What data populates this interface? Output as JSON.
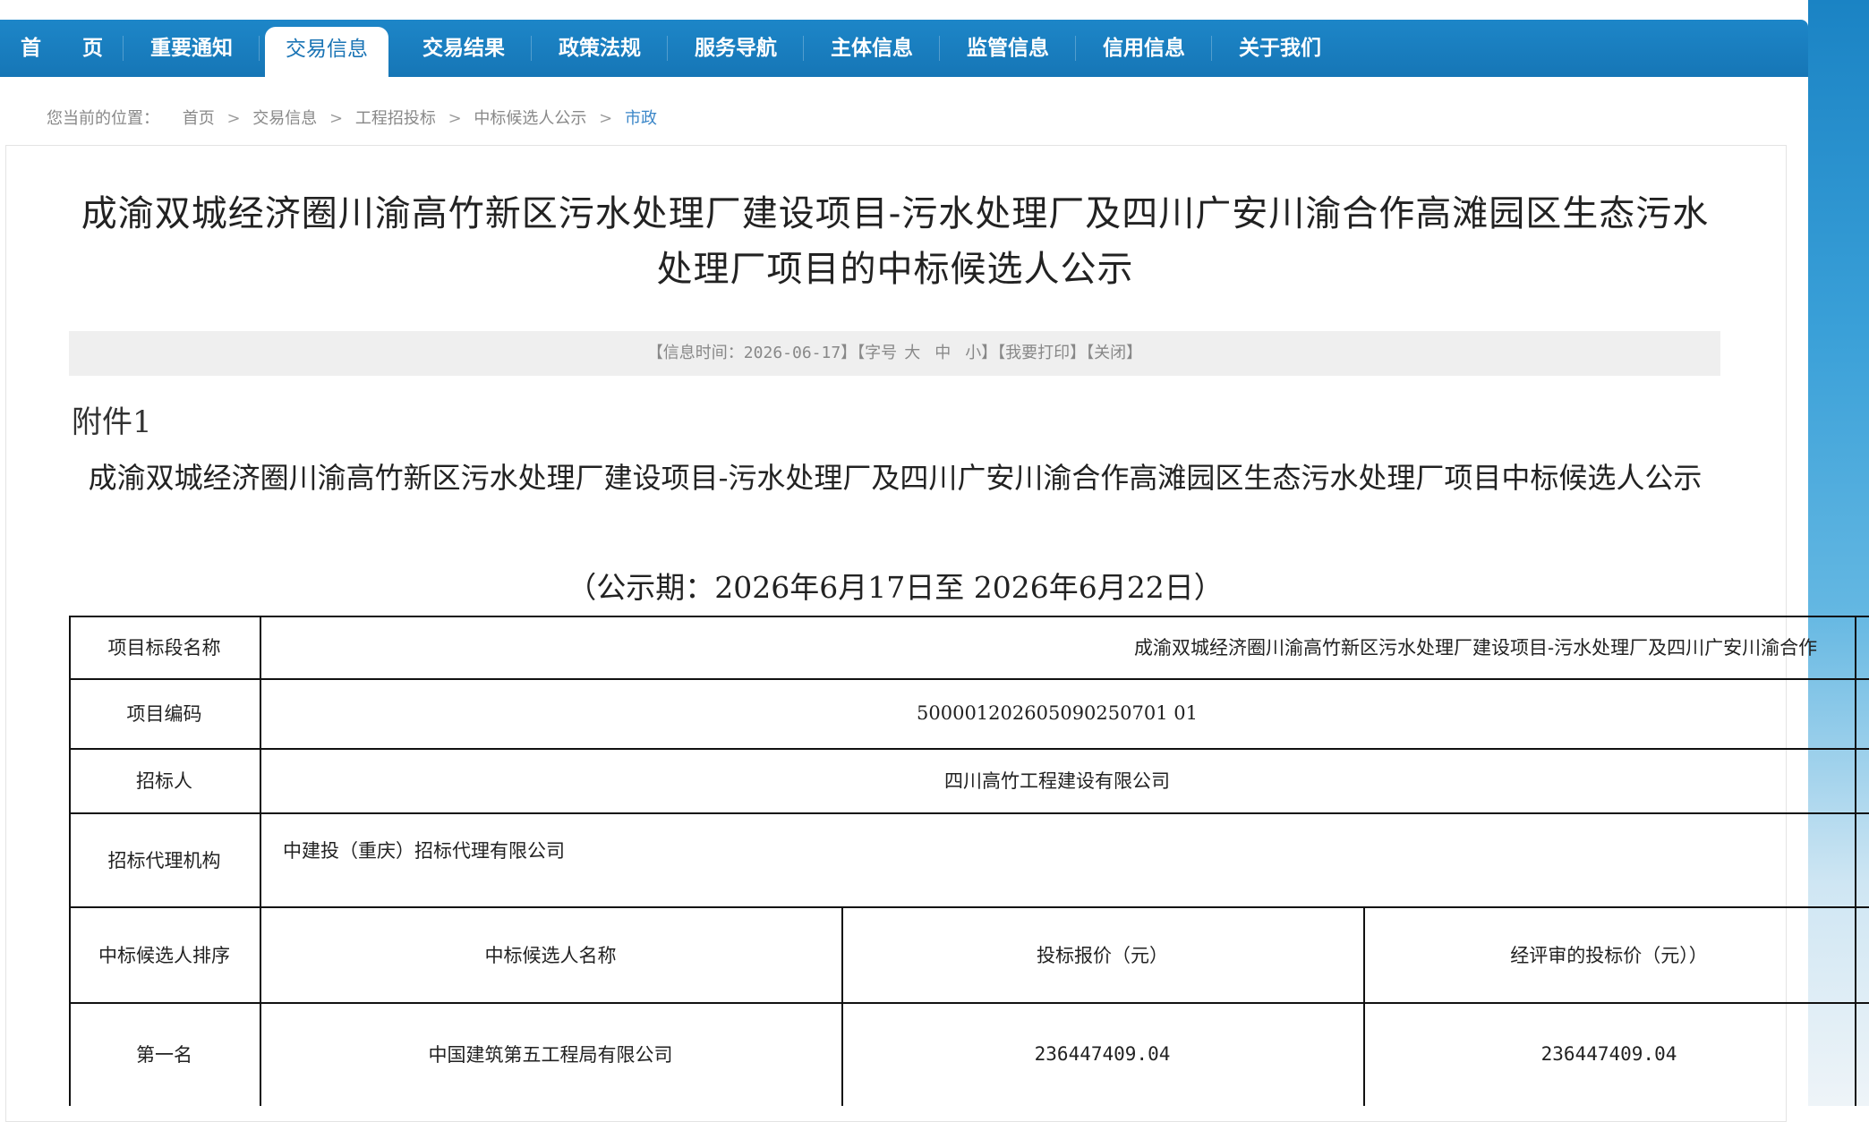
{
  "nav": {
    "items": [
      "首　　页",
      "重要通知",
      "交易信息",
      "交易结果",
      "政策法规",
      "服务导航",
      "主体信息",
      "监管信息",
      "信用信息",
      "关于我们"
    ],
    "active_index": 2
  },
  "breadcrumb": {
    "lead": "您当前的位置：",
    "items": [
      "首页",
      "交易信息",
      "工程招投标",
      "中标候选人公示",
      "市政"
    ],
    "separator": ">"
  },
  "article": {
    "title": "成渝双城经济圈川渝高竹新区污水处理厂建设项目-污水处理厂及四川广安川渝合作高滩园区生态污水处理厂项目的中标候选人公示",
    "info_bar": {
      "date_label": "【信息时间：2026-06-17】",
      "font_label": "【字号",
      "font_large": "大",
      "font_medium": "中",
      "font_small": "小】",
      "print_label": "【我要打印】",
      "close_label": "【关闭】"
    },
    "attachment_label": "附件1",
    "doc_title": "成渝双城经济圈川渝高竹新区污水处理厂建设项目-污水处理厂及四川广安川渝合作高滩园区生态污水处理厂项目中标候选人公示",
    "period": "（公示期：2026年6月17日至 2026年6月22日）"
  },
  "table": {
    "project_name_label": "项目标段名称",
    "project_name_value": "成渝双城经济圈川渝高竹新区污水处理厂建设项目-污水处理厂及四川广安川渝合作",
    "project_code_label": "项目编码",
    "project_code_value": "500001202605090250701 01",
    "tenderer_label": "招标人",
    "tenderer_value": "四川高竹工程建设有限公司",
    "agency_label": "招标代理机构",
    "agency_value": "中建投（重庆）招标代理有限公司",
    "headers": [
      "中标候选人排序",
      "中标候选人名称",
      "投标报价（元）",
      "经评审的投标价（元））"
    ],
    "rows": [
      {
        "rank": "第一名",
        "name": "中国建筑第五工程局有限公司",
        "bid": "236447409.04",
        "evaluated": "236447409.04"
      }
    ]
  },
  "colors": {
    "nav_bg": "#1676b6",
    "active_tab_text": "#1a74b5",
    "breadcrumb_current": "#3a86c8",
    "info_bar_bg": "#efefef"
  }
}
